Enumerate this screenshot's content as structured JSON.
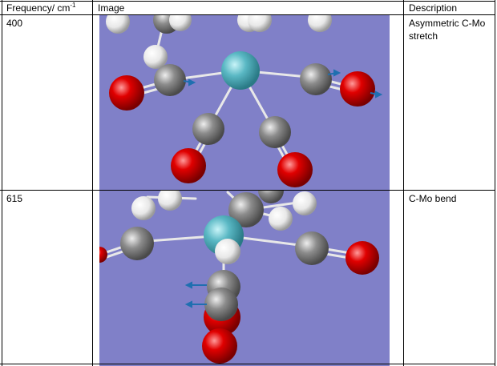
{
  "table": {
    "headers": {
      "frequency": "Frequency/ cm",
      "frequency_sup": "-1",
      "image": "Image",
      "description": "Description"
    },
    "rows": [
      {
        "frequency": "400",
        "description": "Asymmetric C-Mo stretch"
      },
      {
        "frequency": "615",
        "description": "C-Mo bend"
      }
    ]
  },
  "colors": {
    "render_background": "#8080c8",
    "molybdenum": "#5ab8c4",
    "carbon": "#8c8c8c",
    "oxygen": "#e00000",
    "hydrogen": "#f0f0f0",
    "vector_arrow": "#1f6fb0"
  }
}
